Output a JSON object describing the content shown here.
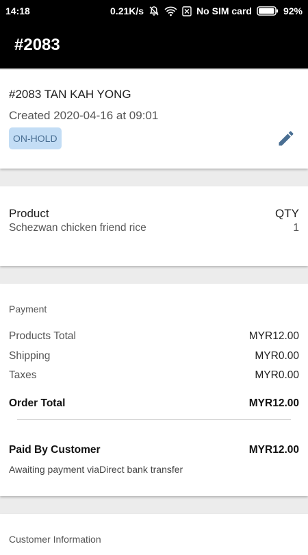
{
  "status_bar": {
    "time": "14:18",
    "speed": "0.21K/s",
    "sim": "No SIM card",
    "battery": "92%",
    "icons": [
      "bell-off-icon",
      "wifi-icon",
      "no-sim-icon",
      "battery-icon"
    ]
  },
  "app_bar": {
    "title": "#2083"
  },
  "order": {
    "title": "#2083 TAN KAH YONG",
    "created": "Created 2020-04-16 at 09:01",
    "status": "ON-HOLD",
    "status_color": "#c3ddf5",
    "edit_icon": "pencil-icon"
  },
  "products": {
    "header_product": "Product",
    "header_qty": "QTY",
    "items": [
      {
        "name": "Schezwan chicken friend rice",
        "qty": "1"
      }
    ]
  },
  "payment": {
    "label": "Payment",
    "products_total_label": "Products Total",
    "products_total": "MYR12.00",
    "shipping_label": "Shipping",
    "shipping": "MYR0.00",
    "taxes_label": "Taxes",
    "taxes": "MYR0.00",
    "order_total_label": "Order Total",
    "order_total": "MYR12.00",
    "paid_label": "Paid By Customer",
    "paid": "MYR12.00",
    "note": "Awaiting payment viaDirect bank transfer"
  },
  "customer": {
    "label": "Customer Information"
  }
}
